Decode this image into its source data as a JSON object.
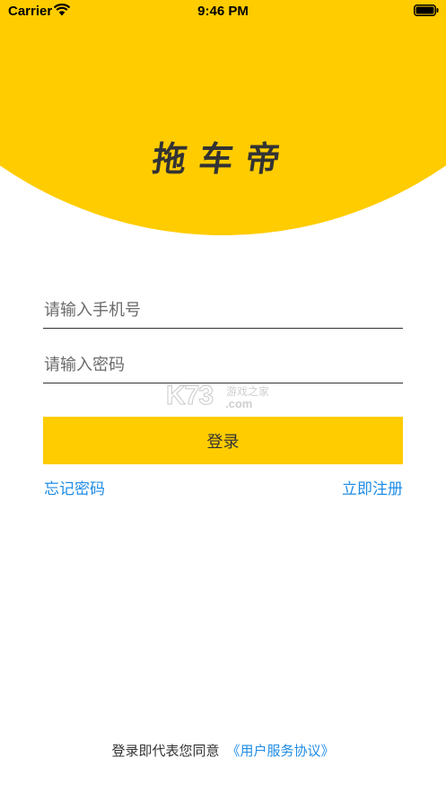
{
  "status_bar": {
    "carrier": "Carrier",
    "time": "9:46 PM",
    "icons": [
      "wifi-icon",
      "battery-icon"
    ]
  },
  "header": {
    "logo_text": "拖车帝",
    "background_color": "#ffcc00"
  },
  "login_form": {
    "phone_placeholder": "请输入手机号",
    "password_placeholder": "请输入密码",
    "login_label": "登录",
    "button_color": "#ffcc00",
    "forgot_password": "忘记密码",
    "register_now": "立即注册",
    "link_color": "#1f8ce6"
  },
  "watermark": {
    "brand": "K73",
    "site_text": "游戏之家",
    "domain": ".com"
  },
  "footer": {
    "agreement_prefix": "登录即代表您同意",
    "agreement_link": "《用户服务协议》"
  }
}
